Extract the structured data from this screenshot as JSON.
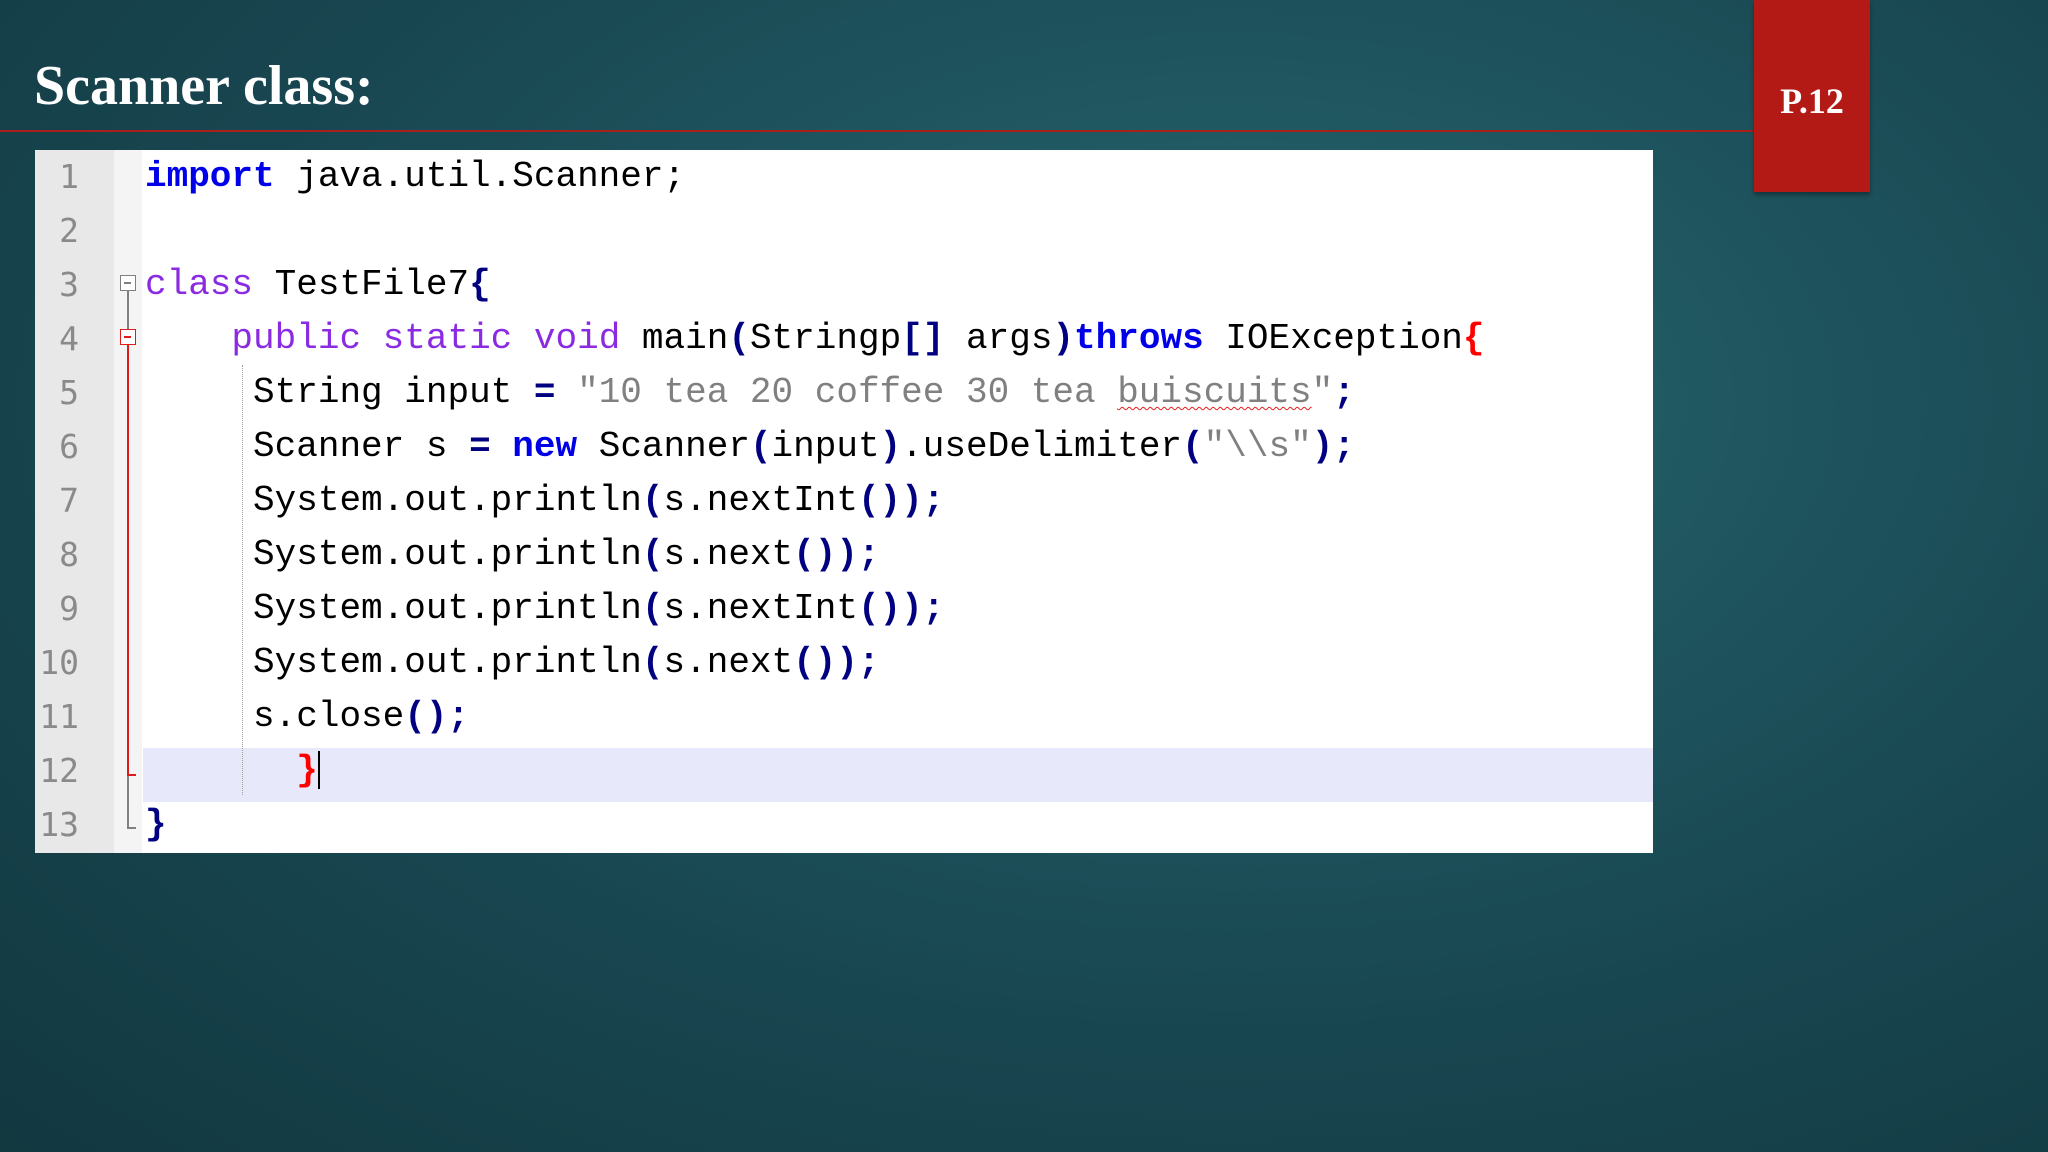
{
  "slide": {
    "title": "Scanner class:",
    "page_label": "P.12",
    "accent_color": "#b31a16",
    "background_color": "#1d4f58"
  },
  "editor": {
    "line_numbers": [
      "1",
      "2",
      "3",
      "4",
      "5",
      "6",
      "7",
      "8",
      "9",
      "10",
      "11",
      "12",
      "13"
    ],
    "current_line": 12,
    "code": {
      "l1": {
        "kw_import": "import",
        "rest": " java.util.Scanner;"
      },
      "l3": {
        "kw_class": "class",
        "rest": " TestFile7",
        "brace": "{"
      },
      "l4": {
        "indent": "    ",
        "kw_public": "public",
        "kw_static": "static",
        "kw_void": "void",
        "name": "main",
        "paren_open": "(",
        "param_type": "Stringp",
        "brackets": "[]",
        "param_name": " args",
        "paren_close": ")",
        "kw_throws": "throws",
        "exception": " IOException",
        "brace": "{"
      },
      "l5": {
        "indent": "     ",
        "type": "String input ",
        "op": "=",
        "str_open": " \"10 tea 20 coffee 30 tea ",
        "misspelled": "buiscuits",
        "str_close": "\"",
        "semi": ";"
      },
      "l6": {
        "indent": "     ",
        "prefix": "Scanner s ",
        "op": "=",
        "kw_new": "new",
        "ctor": " Scanner",
        "po1": "(",
        "arg": "input",
        "pc1": ")",
        "method": ".useDelimiter",
        "po2": "(",
        "str": "\"\\\\s\"",
        "pc2": ")",
        "semi": ";"
      },
      "l7": {
        "indent": "     ",
        "call": "System.out.println",
        "po": "(",
        "arg": "s.nextInt",
        "inner": "()",
        "pc": ")",
        "semi": ";"
      },
      "l8": {
        "indent": "     ",
        "call": "System.out.println",
        "po": "(",
        "arg": "s.next",
        "inner": "()",
        "pc": ")",
        "semi": ";"
      },
      "l9": {
        "indent": "     ",
        "call": "System.out.println",
        "po": "(",
        "arg": "s.nextInt",
        "inner": "()",
        "pc": ")",
        "semi": ";"
      },
      "l10": {
        "indent": "     ",
        "call": "System.out.println",
        "po": "(",
        "arg": "s.next",
        "inner": "()",
        "pc": ")",
        "semi": ";"
      },
      "l11": {
        "indent": "     ",
        "call": "s.close",
        "inner": "()",
        "semi": ";"
      },
      "l12": {
        "indent": "       ",
        "brace": "}"
      },
      "l13": {
        "brace": "}"
      }
    },
    "colors": {
      "keyword": "#0000e8",
      "type_keyword": "#8a2be2",
      "string": "#808080",
      "operator": "#000080",
      "matched_brace": "#ff0000",
      "current_line_bg": "#e8e8fb"
    }
  }
}
